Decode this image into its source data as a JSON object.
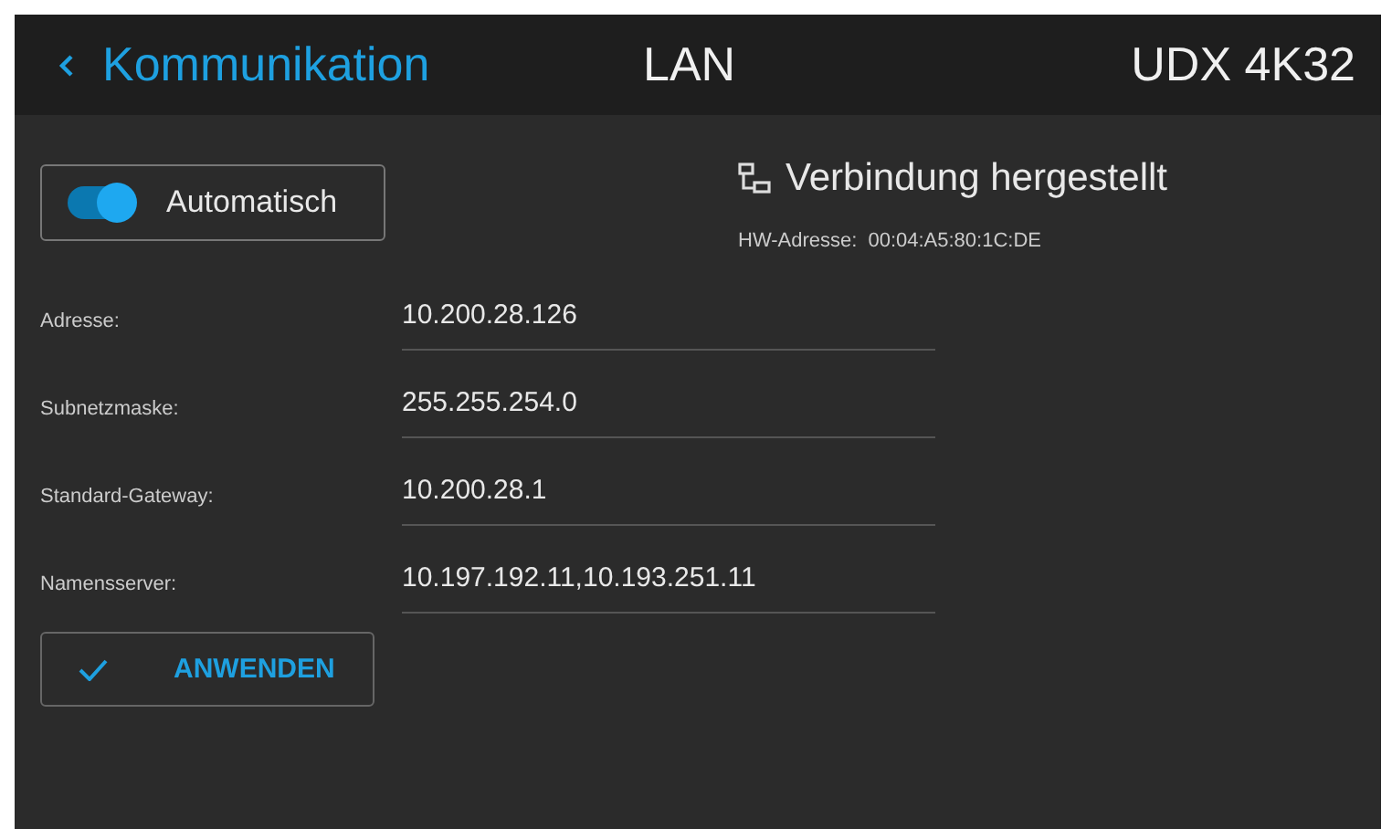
{
  "header": {
    "back_label": "Kommunikation",
    "title": "LAN",
    "device": "UDX 4K32"
  },
  "auto_toggle": {
    "label": "Automatisch",
    "on": true
  },
  "status": {
    "text": "Verbindung hergestellt",
    "hw_label": "HW-Adresse:",
    "hw_value": "00:04:A5:80:1C:DE"
  },
  "fields": [
    {
      "label": "Adresse:",
      "value": "10.200.28.126"
    },
    {
      "label": "Subnetzmaske:",
      "value": "255.255.254.0"
    },
    {
      "label": "Standard-Gateway:",
      "value": "10.200.28.1"
    },
    {
      "label": "Namensserver:",
      "value": "10.197.192.11,10.193.251.11"
    }
  ],
  "apply_button": {
    "label": "ANWENDEN"
  }
}
